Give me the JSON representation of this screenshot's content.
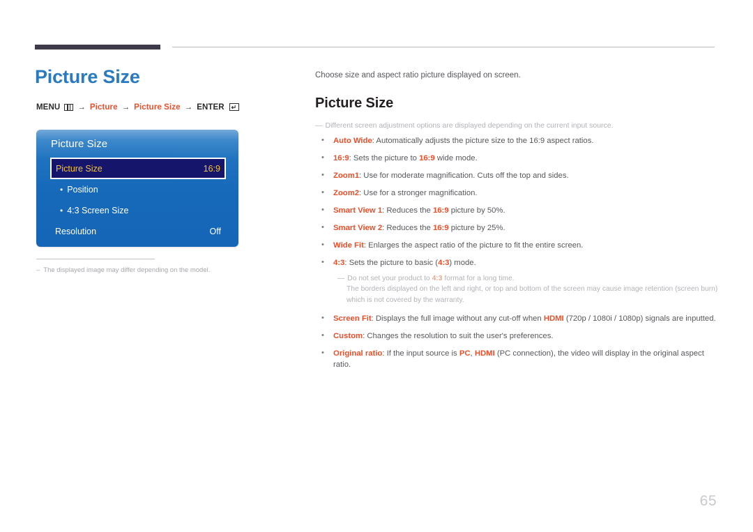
{
  "header": {
    "rule_thick": "",
    "rule_thin": ""
  },
  "left": {
    "title": "Picture Size",
    "menu_path": {
      "menu_label": "MENU",
      "menu_icon": "menu-grid-icon",
      "arrow": "→",
      "step1": "Picture",
      "step2": "Picture Size",
      "enter_label": "ENTER",
      "enter_icon": "enter-return-icon"
    },
    "osd": {
      "title": "Picture Size",
      "rows": [
        {
          "label": "Picture Size",
          "value": "16:9",
          "selected": true,
          "sub": false
        },
        {
          "label": "Position",
          "value": "",
          "selected": false,
          "sub": true
        },
        {
          "label": "4:3 Screen Size",
          "value": "",
          "selected": false,
          "sub": true
        },
        {
          "label": "Resolution",
          "value": "Off",
          "selected": false,
          "sub": false
        }
      ]
    },
    "footnote": {
      "dash": "–",
      "text": "The displayed image may differ depending on the model."
    }
  },
  "right": {
    "intro": "Choose size and aspect ratio picture displayed on screen.",
    "title": "Picture Size",
    "note": {
      "dash": "—",
      "text": "Different screen adjustment options are displayed depending on the current input source."
    },
    "bullets": [
      {
        "dot": "•",
        "term": "Auto Wide",
        "rest": ": Automatically adjusts the picture size to the 16:9 aspect ratios."
      },
      {
        "dot": "•",
        "term": "16:9",
        "rest_a": ": Sets the picture to ",
        "hl": "16:9",
        "rest_b": " wide mode."
      },
      {
        "dot": "•",
        "term": "Zoom1",
        "rest": ": Use for moderate magnification. Cuts off the top and sides."
      },
      {
        "dot": "•",
        "term": "Zoom2",
        "rest": ": Use for a stronger magnification."
      },
      {
        "dot": "•",
        "term": "Smart View 1",
        "rest_a": ": Reduces the ",
        "hl": "16:9",
        "rest_b": " picture by 50%."
      },
      {
        "dot": "•",
        "term": "Smart View 2",
        "rest_a": ": Reduces the ",
        "hl": "16:9",
        "rest_b": " picture by 25%."
      },
      {
        "dot": "•",
        "term": "Wide Fit",
        "rest": ": Enlarges the aspect ratio of the picture to fit the entire screen."
      },
      {
        "dot": "•",
        "term": "4:3",
        "rest_a": ": Sets the picture to basic (",
        "hl": "4:3",
        "rest_b": ") mode."
      }
    ],
    "subnote": {
      "dash": "—",
      "line1_a": "Do not set your product to ",
      "line1_hl": "4:3",
      "line1_b": " format for a long time.",
      "line2": "The borders displayed on the left and right, or top and bottom of the screen may cause image retention (screen burn)",
      "line3": "which is not covered by the warranty."
    },
    "bullets2": [
      {
        "dot": "•",
        "term": "Screen Fit",
        "rest_a": ": Displays the full image without any cut-off when ",
        "hl": "HDMI",
        "rest_b": " (720p / 1080i / 1080p) signals are inputted."
      },
      {
        "dot": "•",
        "term": "Custom",
        "rest": ": Changes the resolution to suit the user's preferences."
      },
      {
        "dot": "•",
        "term": "Original ratio",
        "rest_a": ": If the input source is ",
        "hl": "PC",
        "rest_mid": ", ",
        "hl2": "HDMI",
        "rest_b": " (PC connection), the video will display in the original aspect ratio."
      }
    ]
  },
  "page_number": "65",
  "colors": {
    "accent_orange": "#e8502a",
    "heading_blue": "#2a7ac0",
    "osd_blue": "#1668b9",
    "osd_selected_bg": "#15156b",
    "osd_selected_text": "#f4c33c",
    "body_gray": "#58585c",
    "muted_gray": "#b3b3b8"
  }
}
